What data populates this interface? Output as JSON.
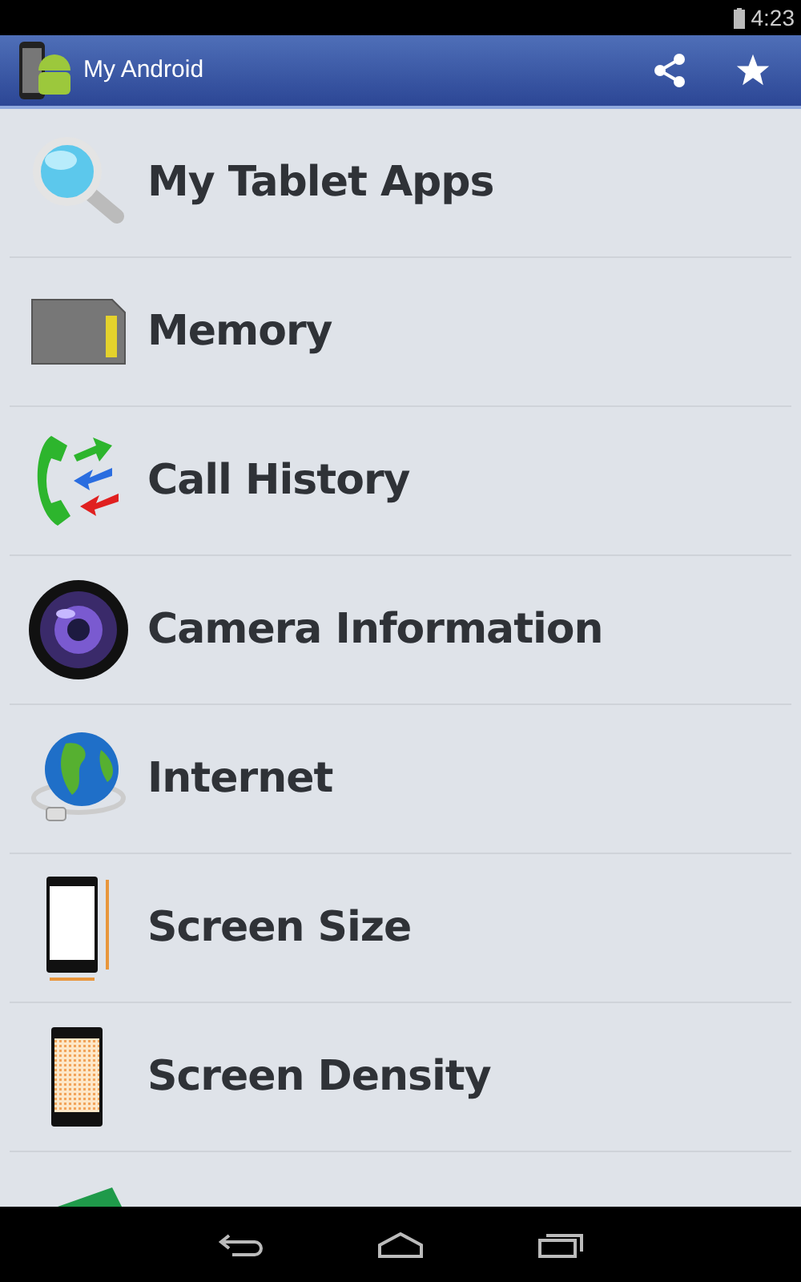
{
  "status_bar": {
    "time": "4:23"
  },
  "action_bar": {
    "title": "My Android"
  },
  "items": [
    {
      "kind": "magnifier",
      "label": "My Tablet Apps"
    },
    {
      "kind": "sdcard",
      "label": "Memory"
    },
    {
      "kind": "calls",
      "label": "Call History"
    },
    {
      "kind": "camera",
      "label": "Camera Information"
    },
    {
      "kind": "globe",
      "label": "Internet"
    },
    {
      "kind": "screen-size",
      "label": "Screen Size"
    },
    {
      "kind": "screen-density",
      "label": "Screen Density"
    },
    {
      "kind": "board"
    }
  ]
}
